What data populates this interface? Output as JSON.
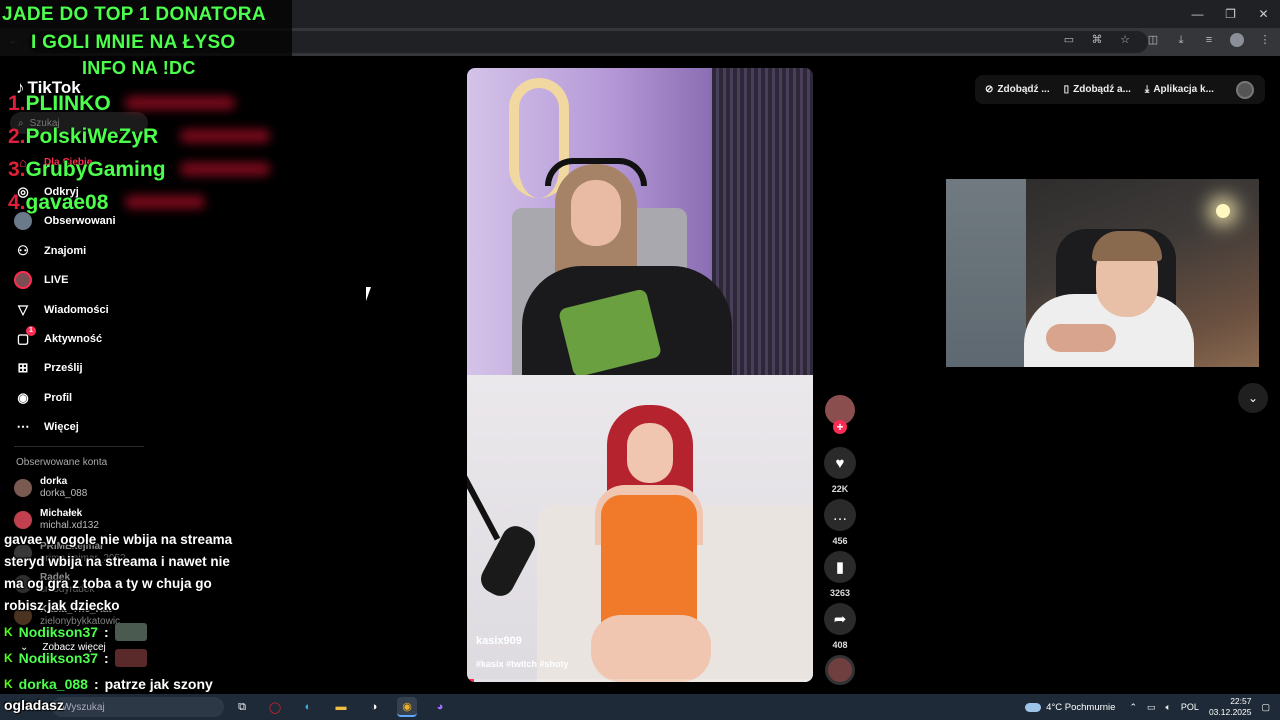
{
  "overlay": {
    "line1": "JADE DO TOP 1 DONATORA",
    "line2": "I GOLI MNIE NA ŁYSO",
    "line3": "INFO NA !DC",
    "color": "#4cff4c"
  },
  "leaderboard": [
    {
      "rank": "1.",
      "name": "PLIINKO"
    },
    {
      "rank": "2.",
      "name": "PolskiWeZyR"
    },
    {
      "rank": "3.",
      "name": "GrubyGaming"
    },
    {
      "rank": "4.",
      "name": "gavae08"
    }
  ],
  "tiktok": {
    "logo": "TikTok",
    "search_placeholder": "Szukaj",
    "nav": [
      {
        "label": "Dla Ciebie",
        "icon": "home-icon"
      },
      {
        "label": "Odkryj",
        "icon": "compass-icon"
      },
      {
        "label": "Obserwowani",
        "icon": "avatar-icon"
      },
      {
        "label": "Znajomi",
        "icon": "friends-icon"
      },
      {
        "label": "LIVE",
        "icon": "live-icon"
      },
      {
        "label": "Wiadomości",
        "icon": "send-icon"
      },
      {
        "label": "Aktywność",
        "icon": "inbox-icon",
        "badge": "1"
      },
      {
        "label": "Prześlij",
        "icon": "upload-icon"
      },
      {
        "label": "Profil",
        "icon": "profile-icon"
      },
      {
        "label": "Więcej",
        "icon": "more-icon"
      }
    ],
    "followed_title": "Obserwowane konta",
    "followed": [
      {
        "name": "dorka",
        "user": "dorka_088"
      },
      {
        "name": "Michałek",
        "user": "michal.xd132"
      },
      {
        "name": "PRIMEkejmar",
        "user": "prime.kejmar_2052"
      },
      {
        "name": "Radek",
        "user": "smodyradek"
      },
      {
        "name": "Kasia_The_Kat",
        "user": "zielonybykkatowic"
      }
    ],
    "see_more": "Zobacz więcej"
  },
  "chat": {
    "lines": [
      "gavae w ogole nie wbija na streama",
      "steryd wbija na streama i nawet nie",
      "ma og gra z toba a ty w chuja go",
      "robisz jak dziecko"
    ],
    "users": [
      {
        "name": "Nodikson37",
        "sep": ":"
      },
      {
        "name": "Nodikson37",
        "sep": ":"
      },
      {
        "name": "dorka_088",
        "sep": ":",
        "msg": "patrze jak szony"
      }
    ],
    "last_line": "ogladasz"
  },
  "video": {
    "username": "kasix909",
    "tags": "#kasix #twitch #shoty",
    "progress": 0.02
  },
  "actions": {
    "likes": "22K",
    "comments": "456",
    "saves": "3263",
    "shares": "408"
  },
  "top_menu": {
    "item1": "Zdobądź ...",
    "item2": "Zdobądź a...",
    "item3": "Aplikacja k..."
  },
  "taskbar": {
    "search": "Wyszukaj",
    "weather": "4°C  Pochmurnie",
    "lang": "POL",
    "time": "22:57",
    "date": "03.12.2025"
  }
}
